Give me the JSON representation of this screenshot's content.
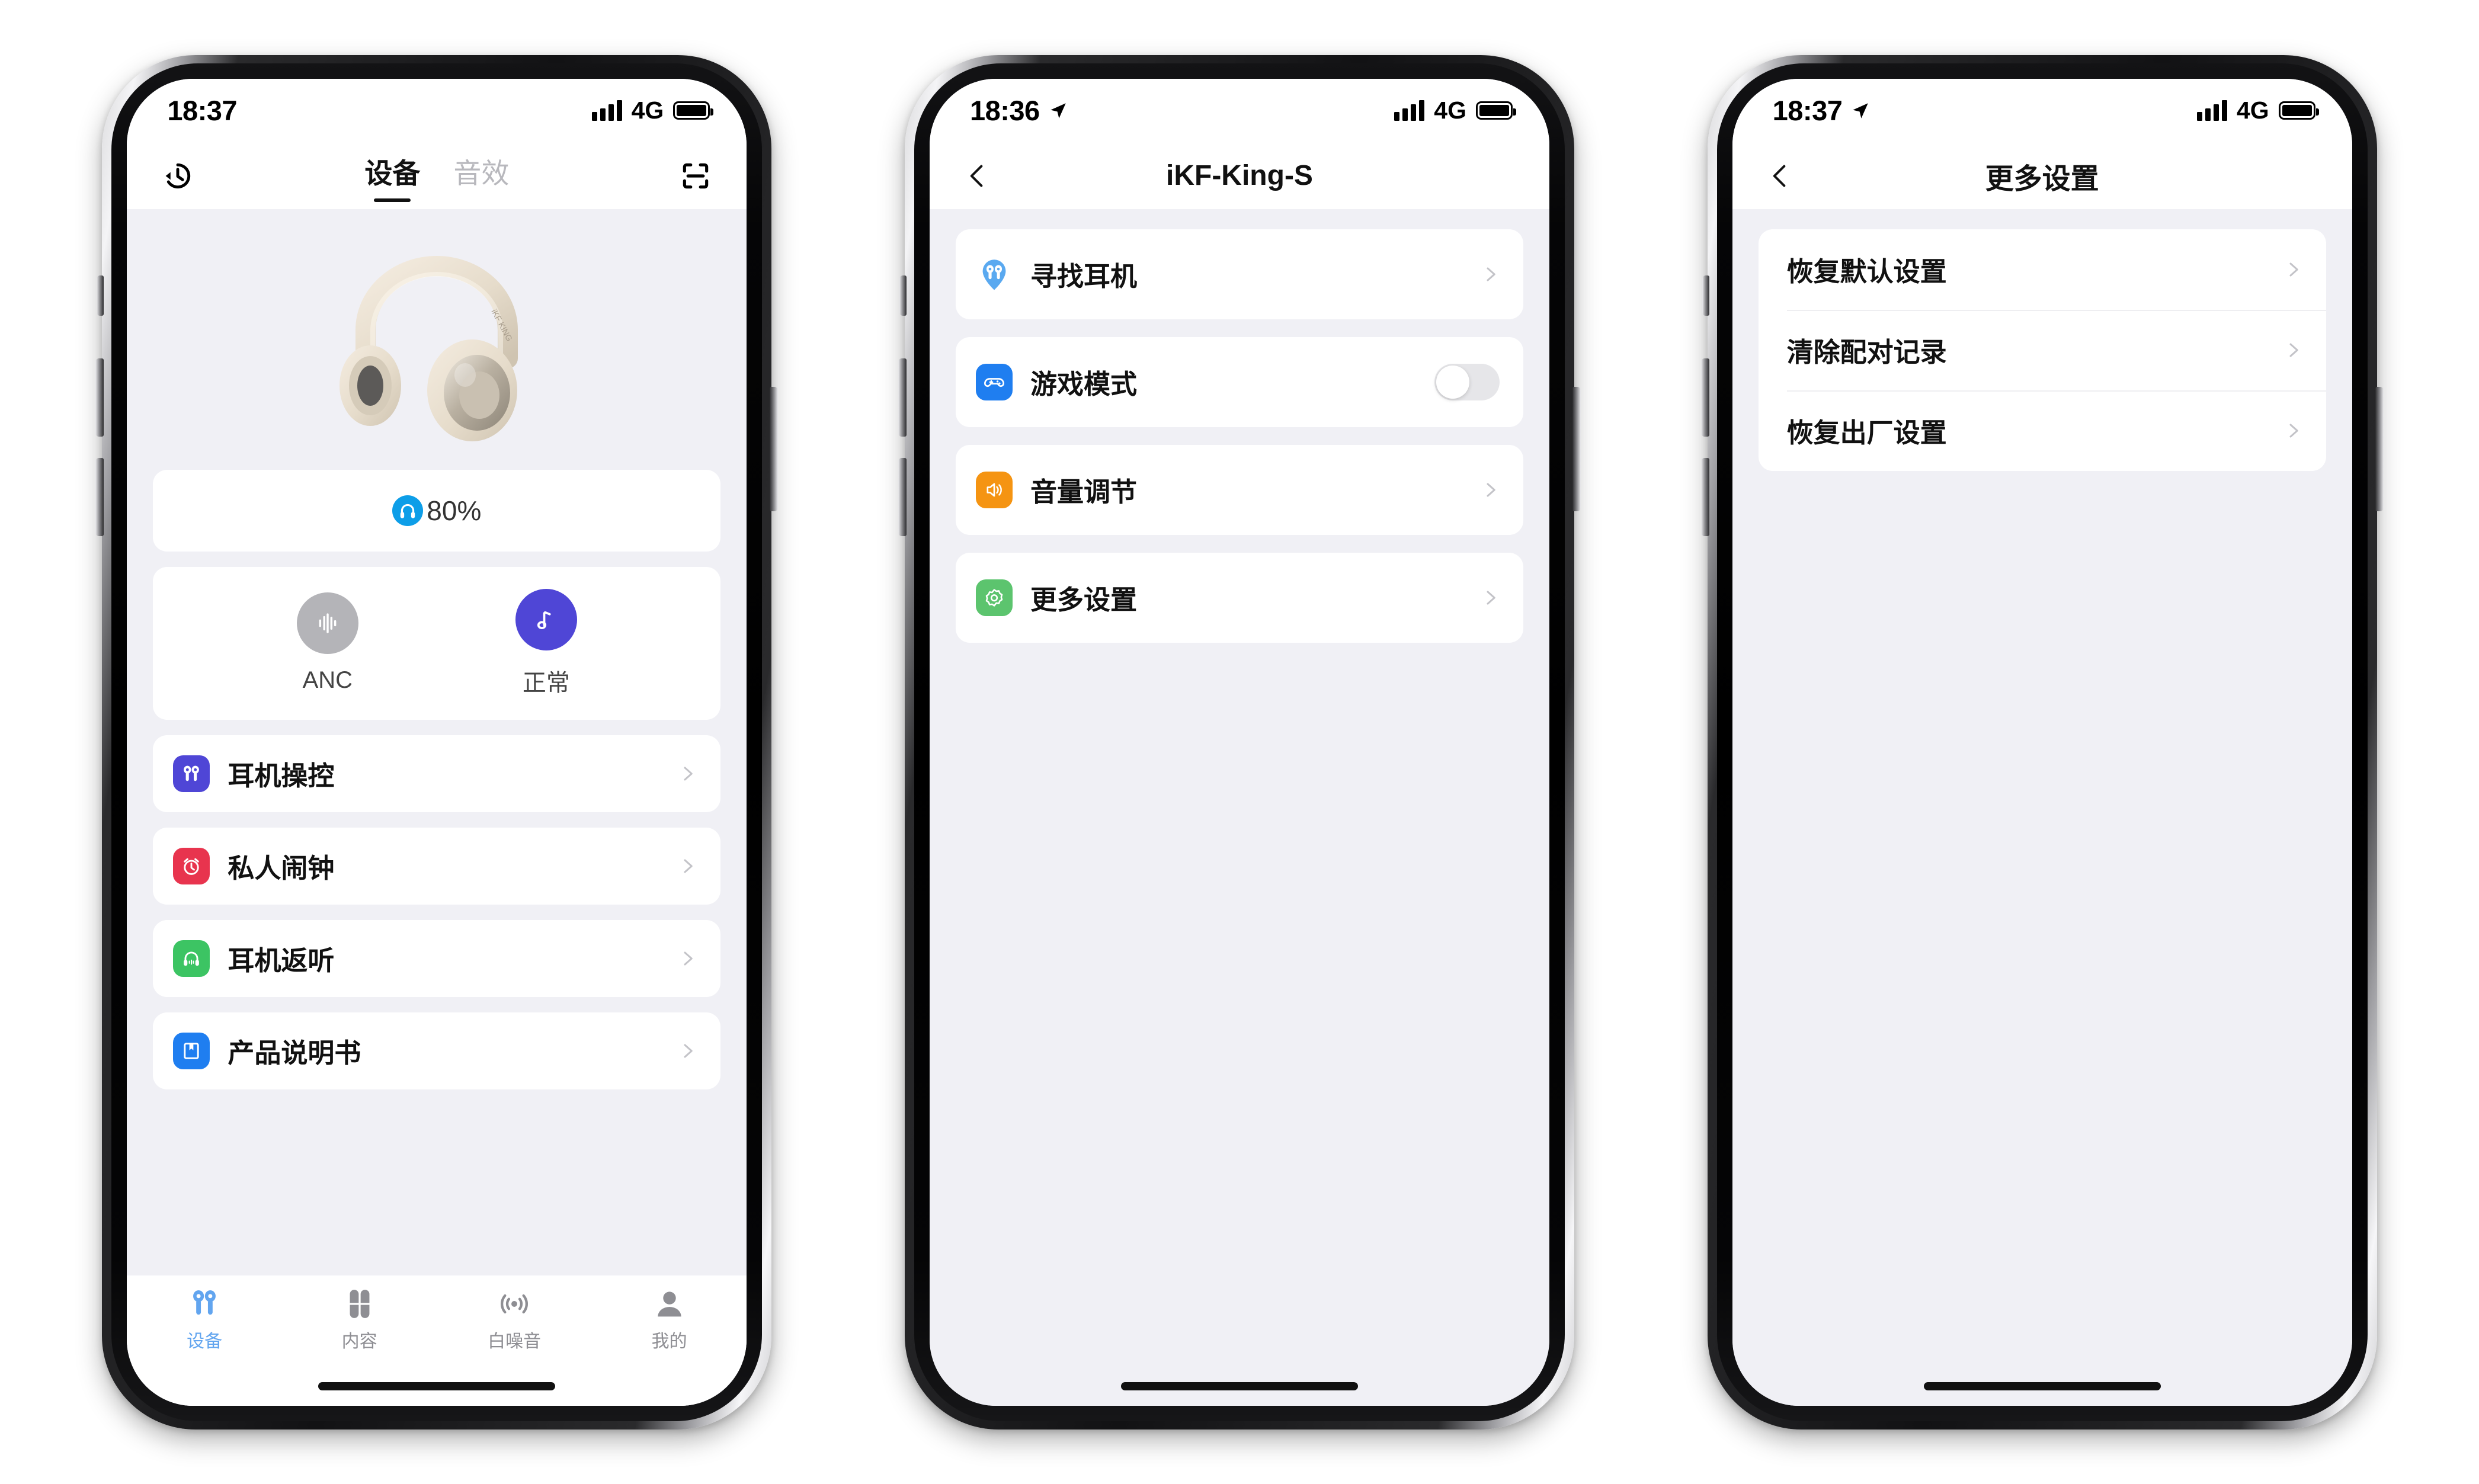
{
  "colors": {
    "screen_bg": "#f0f0f5",
    "card_bg": "#ffffff",
    "accent_blue": "#0d9ee8",
    "tab_active_blue": "#62a5ef",
    "mode_active_purple": "#4f46d6",
    "mode_inactive_gray": "#b4b4b8",
    "icon_purple": "#4f46d6",
    "icon_red": "#e8344e",
    "icon_green": "#3cc463",
    "icon_blue": "#1f7ef0",
    "icon_orange": "#f59412",
    "icon_green_light": "#5cc46e",
    "icon_blue_pin": "#5aa9f0",
    "toggle_off_track": "#e6e6e9"
  },
  "phone1": {
    "status_bar": {
      "time": "18:37",
      "network": "4G",
      "signal_icon": "signal-bars-icon",
      "battery_icon": "battery-full-icon",
      "location_icon": null
    },
    "header": {
      "history_icon": "history-clock-icon",
      "scan_icon": "scan-frame-icon",
      "tabs": [
        {
          "label": "设备",
          "active": true
        },
        {
          "label": "音效",
          "active": false
        }
      ]
    },
    "hero": {
      "product_image": "headphones-image",
      "brand_text": "iKF KING"
    },
    "battery_card": {
      "icon": "headphone-badge-icon",
      "percent": "80%"
    },
    "modes": [
      {
        "label": "ANC",
        "icon": "waveform-icon",
        "active": false
      },
      {
        "label": "正常",
        "icon": "music-note-icon",
        "active": true
      }
    ],
    "list": [
      {
        "label": "耳机操控",
        "icon": "earbuds-icon",
        "color": "#4f46d6"
      },
      {
        "label": "私人闹钟",
        "icon": "alarm-clock-icon",
        "color": "#e8344e"
      },
      {
        "label": "耳机返听",
        "icon": "headphone-monitor-icon",
        "color": "#3cc463"
      },
      {
        "label": "产品说明书",
        "icon": "manual-book-icon",
        "color": "#1f7ef0"
      }
    ],
    "tabbar": [
      {
        "label": "设备",
        "icon": "earbuds-icon",
        "active": true
      },
      {
        "label": "内容",
        "icon": "grid-petals-icon",
        "active": false
      },
      {
        "label": "白噪音",
        "icon": "sound-waves-icon",
        "active": false
      },
      {
        "label": "我的",
        "icon": "person-icon",
        "active": false
      }
    ]
  },
  "phone2": {
    "status_bar": {
      "time": "18:36",
      "network": "4G",
      "location_icon": "location-arrow-icon",
      "signal_icon": "signal-bars-icon",
      "battery_icon": "battery-full-icon"
    },
    "header": {
      "back_icon": "back-chevron-icon",
      "title": "iKF-King-S"
    },
    "list": [
      {
        "label": "寻找耳机",
        "icon": "find-earbuds-pin-icon",
        "color": "#5aa9f0",
        "accessory": "chevron"
      },
      {
        "label": "游戏模式",
        "icon": "gamepad-icon",
        "color": "#1f7ef0",
        "accessory": "toggle",
        "toggle_on": false
      },
      {
        "label": "音量调节",
        "icon": "volume-speaker-icon",
        "color": "#f59412",
        "accessory": "chevron"
      },
      {
        "label": "更多设置",
        "icon": "gear-icon",
        "color": "#5cc46e",
        "accessory": "chevron"
      }
    ]
  },
  "phone3": {
    "status_bar": {
      "time": "18:37",
      "network": "4G",
      "location_icon": "location-arrow-icon",
      "signal_icon": "signal-bars-icon",
      "battery_icon": "battery-full-icon"
    },
    "header": {
      "back_icon": "back-chevron-icon",
      "title": "更多设置"
    },
    "list": [
      {
        "label": "恢复默认设置"
      },
      {
        "label": "清除配对记录"
      },
      {
        "label": "恢复出厂设置"
      }
    ]
  }
}
